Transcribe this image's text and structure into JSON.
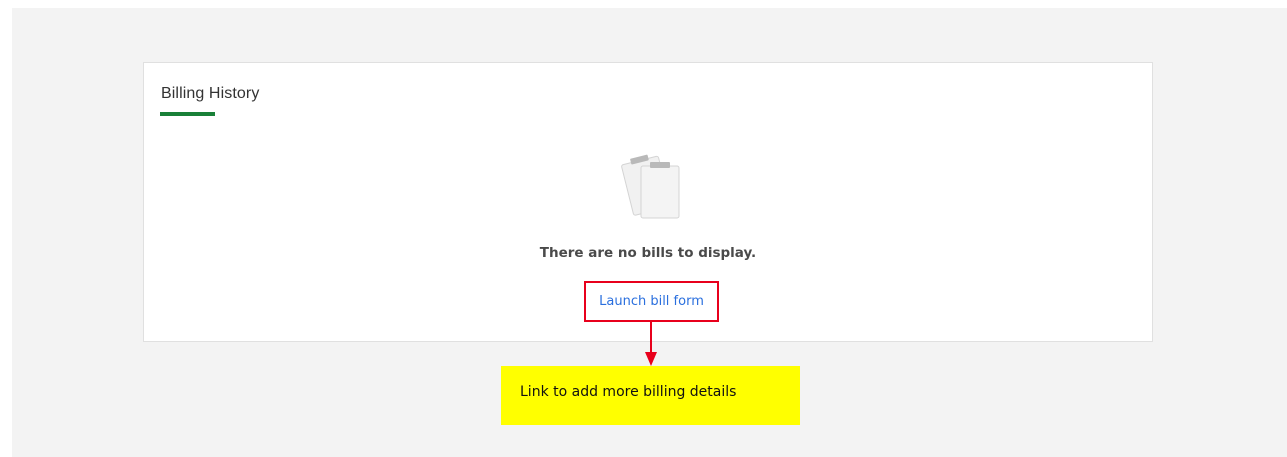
{
  "billing": {
    "title": "Billing History",
    "empty_message": "There are no bills to display.",
    "launch_link": "Launch bill form",
    "accent_color": "#198038",
    "empty_icon": "clipboard-stack-icon"
  },
  "annotation": {
    "text": "Link to add more billing details",
    "box_color": "#ffff00",
    "outline_color": "#e8001c"
  }
}
